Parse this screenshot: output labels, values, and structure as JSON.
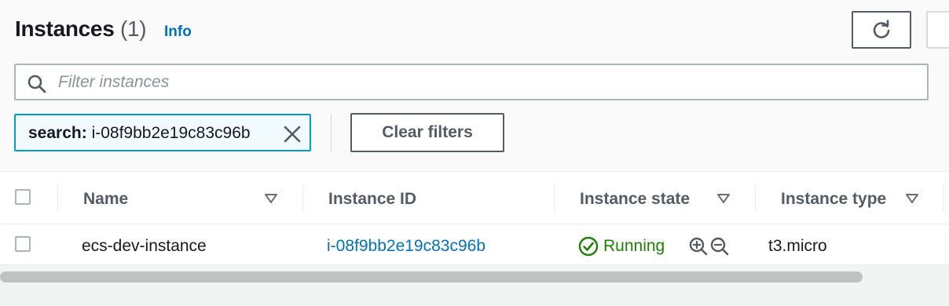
{
  "header": {
    "title": "Instances",
    "count": "(1)",
    "info_label": "Info"
  },
  "search": {
    "placeholder": "Filter instances",
    "value": ""
  },
  "filter_token": {
    "key": "search:",
    "value": "i-08f9bb2e19c83c96b"
  },
  "clear_filters_label": "Clear filters",
  "table": {
    "columns": [
      "Name",
      "Instance ID",
      "Instance state",
      "Instance type"
    ],
    "rows": [
      {
        "name": "ecs-dev-instance",
        "instance_id": "i-08f9bb2e19c83c96b",
        "state": "Running",
        "type": "t3.micro"
      }
    ]
  },
  "icons": {
    "refresh": "refresh-icon",
    "search": "search-icon",
    "remove": "close-icon",
    "sort": "sort-down-icon",
    "status": "check-circle-icon",
    "zoom_in": "zoom-in-icon",
    "zoom_out": "zoom-out-icon"
  },
  "colors": {
    "link": "#0073bb",
    "running": "#1d8102",
    "token_border": "#00a1c9",
    "token_bg": "#f1faff"
  }
}
